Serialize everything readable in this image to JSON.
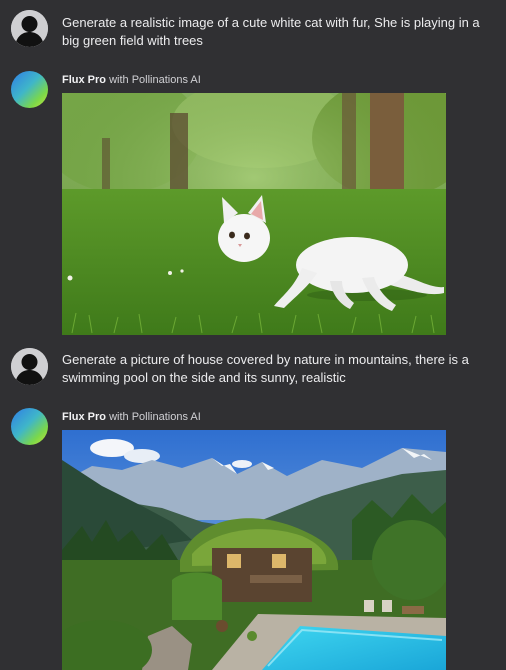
{
  "messages": [
    {
      "role": "user",
      "avatar_icon": "user-silhouette-icon",
      "text": "Generate a realistic image of a cute white cat with fur, She is playing in a big green field with trees"
    },
    {
      "role": "assistant",
      "avatar_icon": "gradient-avatar-icon",
      "model_name": "Flux Pro",
      "provider_text": "with Pollinations AI",
      "image_subject": "white-cat-in-green-field"
    },
    {
      "role": "user",
      "avatar_icon": "user-silhouette-icon",
      "text": "Generate a picture of house covered by nature in mountains, there is a swimming pool on the side and its sunny, realistic"
    },
    {
      "role": "assistant",
      "avatar_icon": "gradient-avatar-icon",
      "model_name": "Flux Pro",
      "provider_text": "with Pollinations AI",
      "image_subject": "mountain-house-with-pool"
    }
  ],
  "colors": {
    "background": "#303033",
    "text": "#ececee",
    "avatar_gradient": [
      "#2f7de6",
      "#7bd84a"
    ]
  }
}
